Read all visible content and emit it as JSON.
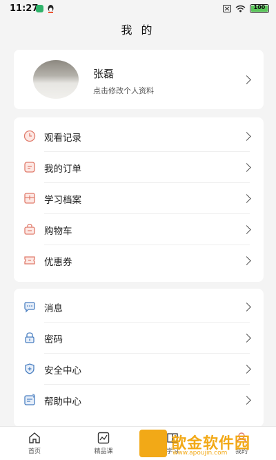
{
  "status": {
    "time": "11:27",
    "battery": "100"
  },
  "header": {
    "title": "我 的"
  },
  "profile": {
    "name": "张磊",
    "subtitle": "点击修改个人资料"
  },
  "menu_group1": [
    {
      "label": "观看记录",
      "icon": "clock-icon"
    },
    {
      "label": "我的订单",
      "icon": "order-icon"
    },
    {
      "label": "学习档案",
      "icon": "archive-icon"
    },
    {
      "label": "购物车",
      "icon": "cart-icon"
    },
    {
      "label": "优惠券",
      "icon": "coupon-icon"
    }
  ],
  "menu_group2": [
    {
      "label": "消息",
      "icon": "message-icon"
    },
    {
      "label": "密码",
      "icon": "lock-icon"
    },
    {
      "label": "安全中心",
      "icon": "shield-icon"
    },
    {
      "label": "帮助中心",
      "icon": "help-icon"
    }
  ],
  "tabbar": [
    {
      "label": "首页",
      "icon": "home-icon"
    },
    {
      "label": "精品课",
      "icon": "chart-icon"
    },
    {
      "label": "学习",
      "icon": "book-icon"
    },
    {
      "label": "我的",
      "icon": "user-icon"
    }
  ],
  "watermark": {
    "brand": "歆金软件园",
    "url": "www.apoujin.com"
  },
  "colors": {
    "accent_red": "#e07a6a",
    "accent_blue": "#4a7fc1",
    "watermark": "#f2a917"
  }
}
